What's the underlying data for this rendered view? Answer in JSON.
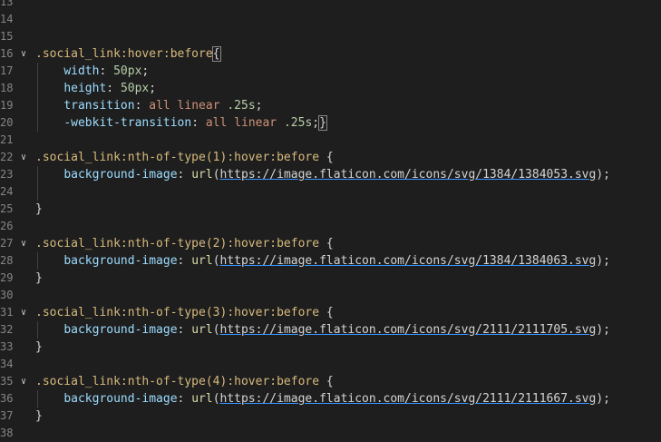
{
  "lines": [
    {
      "n": "13",
      "fold": false,
      "tokens": []
    },
    {
      "n": "14",
      "fold": false,
      "tokens": []
    },
    {
      "n": "15",
      "fold": false,
      "tokens": []
    },
    {
      "n": "16",
      "fold": true,
      "tokens": [
        {
          "t": ".social_link:hover:before",
          "c": "t-sel"
        },
        {
          "t": "{",
          "c": "t-punc t-brace-hl"
        }
      ]
    },
    {
      "n": "17",
      "fold": false,
      "tokens": [
        {
          "t": "    "
        },
        {
          "t": "width",
          "c": "t-prop"
        },
        {
          "t": ": ",
          "c": "t-punc"
        },
        {
          "t": "50px",
          "c": "t-num"
        },
        {
          "t": ";",
          "c": "t-punc"
        }
      ]
    },
    {
      "n": "18",
      "fold": false,
      "tokens": [
        {
          "t": "    "
        },
        {
          "t": "height",
          "c": "t-prop"
        },
        {
          "t": ": ",
          "c": "t-punc"
        },
        {
          "t": "50px",
          "c": "t-num"
        },
        {
          "t": ";",
          "c": "t-punc"
        }
      ]
    },
    {
      "n": "19",
      "fold": false,
      "tokens": [
        {
          "t": "    "
        },
        {
          "t": "transition",
          "c": "t-prop"
        },
        {
          "t": ": ",
          "c": "t-punc"
        },
        {
          "t": "all linear",
          "c": "t-val"
        },
        {
          "t": " "
        },
        {
          "t": ".25s",
          "c": "t-num"
        },
        {
          "t": ";",
          "c": "t-punc"
        }
      ]
    },
    {
      "n": "20",
      "fold": false,
      "tokens": [
        {
          "t": "    "
        },
        {
          "t": "-webkit-transition",
          "c": "t-prop"
        },
        {
          "t": ": ",
          "c": "t-punc"
        },
        {
          "t": "all linear",
          "c": "t-val"
        },
        {
          "t": " "
        },
        {
          "t": ".25s",
          "c": "t-num"
        },
        {
          "t": ";",
          "c": "t-punc"
        },
        {
          "t": "}",
          "c": "t-punc t-brace-hl"
        }
      ]
    },
    {
      "n": "21",
      "fold": false,
      "tokens": []
    },
    {
      "n": "22",
      "fold": true,
      "tokens": [
        {
          "t": ".social_link:nth-of-type(1):hover:before",
          "c": "t-sel"
        },
        {
          "t": " {",
          "c": "t-punc"
        }
      ]
    },
    {
      "n": "23",
      "fold": false,
      "tokens": [
        {
          "t": "    "
        },
        {
          "t": "background-image",
          "c": "t-prop"
        },
        {
          "t": ": ",
          "c": "t-punc"
        },
        {
          "t": "url",
          "c": "t-fn"
        },
        {
          "t": "(",
          "c": "t-punc"
        },
        {
          "t": "https://image.flaticon.com/icons/svg/1384/1384053.svg",
          "c": "t-url"
        },
        {
          "t": ");",
          "c": "t-punc"
        }
      ]
    },
    {
      "n": "24",
      "fold": false,
      "tokens": []
    },
    {
      "n": "25",
      "fold": false,
      "tokens": [
        {
          "t": "}",
          "c": "t-punc"
        }
      ]
    },
    {
      "n": "26",
      "fold": false,
      "tokens": []
    },
    {
      "n": "27",
      "fold": true,
      "tokens": [
        {
          "t": ".social_link:nth-of-type(2):hover:before",
          "c": "t-sel"
        },
        {
          "t": " {",
          "c": "t-punc"
        }
      ]
    },
    {
      "n": "28",
      "fold": false,
      "tokens": [
        {
          "t": "    "
        },
        {
          "t": "background-image",
          "c": "t-prop"
        },
        {
          "t": ": ",
          "c": "t-punc"
        },
        {
          "t": "url",
          "c": "t-fn"
        },
        {
          "t": "(",
          "c": "t-punc"
        },
        {
          "t": "https://image.flaticon.com/icons/svg/1384/1384063.svg",
          "c": "t-url"
        },
        {
          "t": ");",
          "c": "t-punc"
        }
      ]
    },
    {
      "n": "29",
      "fold": false,
      "tokens": [
        {
          "t": "}",
          "c": "t-punc"
        }
      ]
    },
    {
      "n": "30",
      "fold": false,
      "tokens": []
    },
    {
      "n": "31",
      "fold": true,
      "tokens": [
        {
          "t": ".social_link:nth-of-type(3):hover:before",
          "c": "t-sel"
        },
        {
          "t": " {",
          "c": "t-punc"
        }
      ]
    },
    {
      "n": "32",
      "fold": false,
      "tokens": [
        {
          "t": "    "
        },
        {
          "t": "background-image",
          "c": "t-prop"
        },
        {
          "t": ": ",
          "c": "t-punc"
        },
        {
          "t": "url",
          "c": "t-fn"
        },
        {
          "t": "(",
          "c": "t-punc"
        },
        {
          "t": "https://image.flaticon.com/icons/svg/2111/2111705.svg",
          "c": "t-url"
        },
        {
          "t": ");",
          "c": "t-punc"
        }
      ]
    },
    {
      "n": "33",
      "fold": false,
      "tokens": [
        {
          "t": "}",
          "c": "t-punc"
        }
      ]
    },
    {
      "n": "34",
      "fold": false,
      "tokens": []
    },
    {
      "n": "35",
      "fold": true,
      "tokens": [
        {
          "t": ".social_link:nth-of-type(4):hover:before",
          "c": "t-sel"
        },
        {
          "t": " {",
          "c": "t-punc"
        }
      ]
    },
    {
      "n": "36",
      "fold": false,
      "tokens": [
        {
          "t": "    "
        },
        {
          "t": "background-image",
          "c": "t-prop"
        },
        {
          "t": ": ",
          "c": "t-punc"
        },
        {
          "t": "url",
          "c": "t-fn"
        },
        {
          "t": "(",
          "c": "t-punc"
        },
        {
          "t": "https://image.flaticon.com/icons/svg/2111/2111667.svg",
          "c": "t-url"
        },
        {
          "t": ");",
          "c": "t-punc"
        }
      ]
    },
    {
      "n": "37",
      "fold": false,
      "tokens": [
        {
          "t": "}",
          "c": "t-punc"
        }
      ]
    },
    {
      "n": "38",
      "fold": false,
      "tokens": []
    }
  ]
}
